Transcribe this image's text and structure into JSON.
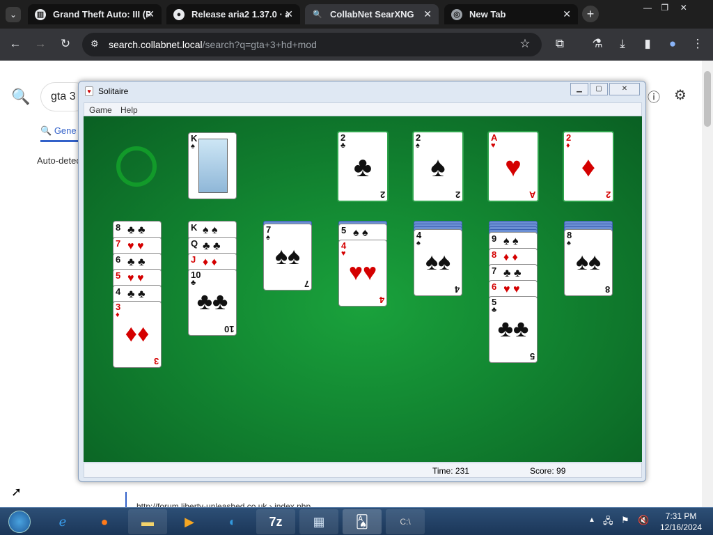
{
  "browser": {
    "tabs": [
      {
        "label": "Grand Theft Auto: III (R",
        "close": "✕"
      },
      {
        "label": "Release aria2 1.37.0 · a",
        "close": "✕"
      },
      {
        "label": "CollabNet SearXNG",
        "close": "✕"
      },
      {
        "label": "New Tab",
        "close": "✕"
      }
    ],
    "new_tab": "+",
    "url_host": "search.collabnet.local",
    "url_path": "/search?q=gta+3+hd+mod"
  },
  "page": {
    "search_value": "gta 3",
    "tab_general": "Gene",
    "auto_detect": "Auto-detec",
    "link_text": "http://forum.liberty-unleashed.co.uk › index.php"
  },
  "solitaire": {
    "title": "Solitaire",
    "menu": {
      "game": "Game",
      "help": "Help"
    },
    "status": {
      "time": "Time:  231",
      "score": "Score: 99"
    },
    "stock_card": {
      "rank": "K",
      "suit": "♠"
    },
    "foundations": [
      {
        "rank": "2",
        "suit": "♣",
        "color": "#111111"
      },
      {
        "rank": "2",
        "suit": "♠",
        "color": "#111111"
      },
      {
        "rank": "A",
        "suit": "♥",
        "color": "#d40000"
      },
      {
        "rank": "2",
        "suit": "♦",
        "color": "#d40000"
      }
    ],
    "tableau": [
      {
        "facedown": 0,
        "cards": [
          [
            "8",
            "♣"
          ],
          [
            "7",
            "♥"
          ],
          [
            "6",
            "♣"
          ],
          [
            "5",
            "♥"
          ],
          [
            "4",
            "♣"
          ],
          [
            "3",
            "♦"
          ]
        ]
      },
      {
        "facedown": 0,
        "cards": [
          [
            "K",
            "♠"
          ],
          [
            "Q",
            "♣"
          ],
          [
            "J",
            "♦"
          ],
          [
            "10",
            "♣"
          ]
        ]
      },
      {
        "facedown": 1,
        "cards": [
          [
            "7",
            "♠"
          ]
        ]
      },
      {
        "facedown": 1,
        "cards": [
          [
            "5",
            "♠"
          ],
          [
            "4",
            "♥"
          ]
        ]
      },
      {
        "facedown": 3,
        "cards": [
          [
            "4",
            "♠"
          ]
        ]
      },
      {
        "facedown": 4,
        "cards": [
          [
            "9",
            "♠"
          ],
          [
            "8",
            "♦"
          ],
          [
            "7",
            "♣"
          ],
          [
            "6",
            "♥"
          ],
          [
            "5",
            "♣"
          ]
        ]
      },
      {
        "facedown": 3,
        "cards": [
          [
            "8",
            "♠"
          ]
        ]
      }
    ]
  },
  "taskbar": {
    "time": "7:31 PM",
    "date": "12/16/2024"
  }
}
